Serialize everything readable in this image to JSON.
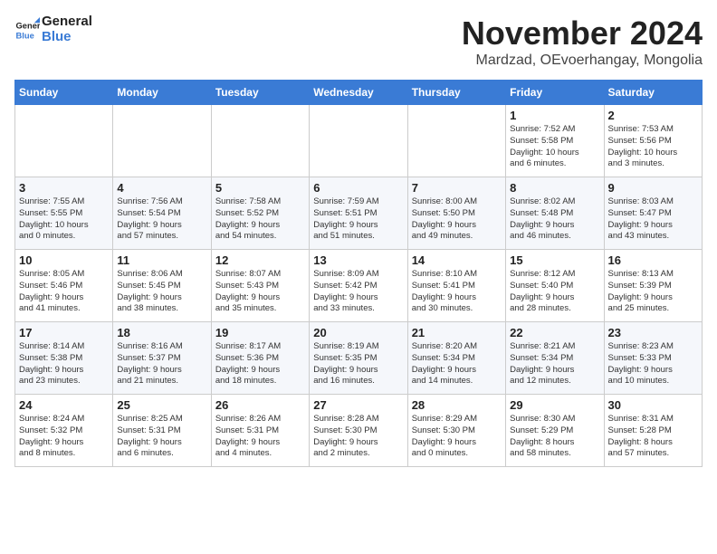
{
  "header": {
    "logo_line1": "General",
    "logo_line2": "Blue",
    "month_title": "November 2024",
    "subtitle": "Mardzad, OEvoerhangay, Mongolia"
  },
  "days_of_week": [
    "Sunday",
    "Monday",
    "Tuesday",
    "Wednesday",
    "Thursday",
    "Friday",
    "Saturday"
  ],
  "weeks": [
    [
      {
        "day": "",
        "info": ""
      },
      {
        "day": "",
        "info": ""
      },
      {
        "day": "",
        "info": ""
      },
      {
        "day": "",
        "info": ""
      },
      {
        "day": "",
        "info": ""
      },
      {
        "day": "1",
        "info": "Sunrise: 7:52 AM\nSunset: 5:58 PM\nDaylight: 10 hours\nand 6 minutes."
      },
      {
        "day": "2",
        "info": "Sunrise: 7:53 AM\nSunset: 5:56 PM\nDaylight: 10 hours\nand 3 minutes."
      }
    ],
    [
      {
        "day": "3",
        "info": "Sunrise: 7:55 AM\nSunset: 5:55 PM\nDaylight: 10 hours\nand 0 minutes."
      },
      {
        "day": "4",
        "info": "Sunrise: 7:56 AM\nSunset: 5:54 PM\nDaylight: 9 hours\nand 57 minutes."
      },
      {
        "day": "5",
        "info": "Sunrise: 7:58 AM\nSunset: 5:52 PM\nDaylight: 9 hours\nand 54 minutes."
      },
      {
        "day": "6",
        "info": "Sunrise: 7:59 AM\nSunset: 5:51 PM\nDaylight: 9 hours\nand 51 minutes."
      },
      {
        "day": "7",
        "info": "Sunrise: 8:00 AM\nSunset: 5:50 PM\nDaylight: 9 hours\nand 49 minutes."
      },
      {
        "day": "8",
        "info": "Sunrise: 8:02 AM\nSunset: 5:48 PM\nDaylight: 9 hours\nand 46 minutes."
      },
      {
        "day": "9",
        "info": "Sunrise: 8:03 AM\nSunset: 5:47 PM\nDaylight: 9 hours\nand 43 minutes."
      }
    ],
    [
      {
        "day": "10",
        "info": "Sunrise: 8:05 AM\nSunset: 5:46 PM\nDaylight: 9 hours\nand 41 minutes."
      },
      {
        "day": "11",
        "info": "Sunrise: 8:06 AM\nSunset: 5:45 PM\nDaylight: 9 hours\nand 38 minutes."
      },
      {
        "day": "12",
        "info": "Sunrise: 8:07 AM\nSunset: 5:43 PM\nDaylight: 9 hours\nand 35 minutes."
      },
      {
        "day": "13",
        "info": "Sunrise: 8:09 AM\nSunset: 5:42 PM\nDaylight: 9 hours\nand 33 minutes."
      },
      {
        "day": "14",
        "info": "Sunrise: 8:10 AM\nSunset: 5:41 PM\nDaylight: 9 hours\nand 30 minutes."
      },
      {
        "day": "15",
        "info": "Sunrise: 8:12 AM\nSunset: 5:40 PM\nDaylight: 9 hours\nand 28 minutes."
      },
      {
        "day": "16",
        "info": "Sunrise: 8:13 AM\nSunset: 5:39 PM\nDaylight: 9 hours\nand 25 minutes."
      }
    ],
    [
      {
        "day": "17",
        "info": "Sunrise: 8:14 AM\nSunset: 5:38 PM\nDaylight: 9 hours\nand 23 minutes."
      },
      {
        "day": "18",
        "info": "Sunrise: 8:16 AM\nSunset: 5:37 PM\nDaylight: 9 hours\nand 21 minutes."
      },
      {
        "day": "19",
        "info": "Sunrise: 8:17 AM\nSunset: 5:36 PM\nDaylight: 9 hours\nand 18 minutes."
      },
      {
        "day": "20",
        "info": "Sunrise: 8:19 AM\nSunset: 5:35 PM\nDaylight: 9 hours\nand 16 minutes."
      },
      {
        "day": "21",
        "info": "Sunrise: 8:20 AM\nSunset: 5:34 PM\nDaylight: 9 hours\nand 14 minutes."
      },
      {
        "day": "22",
        "info": "Sunrise: 8:21 AM\nSunset: 5:34 PM\nDaylight: 9 hours\nand 12 minutes."
      },
      {
        "day": "23",
        "info": "Sunrise: 8:23 AM\nSunset: 5:33 PM\nDaylight: 9 hours\nand 10 minutes."
      }
    ],
    [
      {
        "day": "24",
        "info": "Sunrise: 8:24 AM\nSunset: 5:32 PM\nDaylight: 9 hours\nand 8 minutes."
      },
      {
        "day": "25",
        "info": "Sunrise: 8:25 AM\nSunset: 5:31 PM\nDaylight: 9 hours\nand 6 minutes."
      },
      {
        "day": "26",
        "info": "Sunrise: 8:26 AM\nSunset: 5:31 PM\nDaylight: 9 hours\nand 4 minutes."
      },
      {
        "day": "27",
        "info": "Sunrise: 8:28 AM\nSunset: 5:30 PM\nDaylight: 9 hours\nand 2 minutes."
      },
      {
        "day": "28",
        "info": "Sunrise: 8:29 AM\nSunset: 5:30 PM\nDaylight: 9 hours\nand 0 minutes."
      },
      {
        "day": "29",
        "info": "Sunrise: 8:30 AM\nSunset: 5:29 PM\nDaylight: 8 hours\nand 58 minutes."
      },
      {
        "day": "30",
        "info": "Sunrise: 8:31 AM\nSunset: 5:28 PM\nDaylight: 8 hours\nand 57 minutes."
      }
    ]
  ]
}
